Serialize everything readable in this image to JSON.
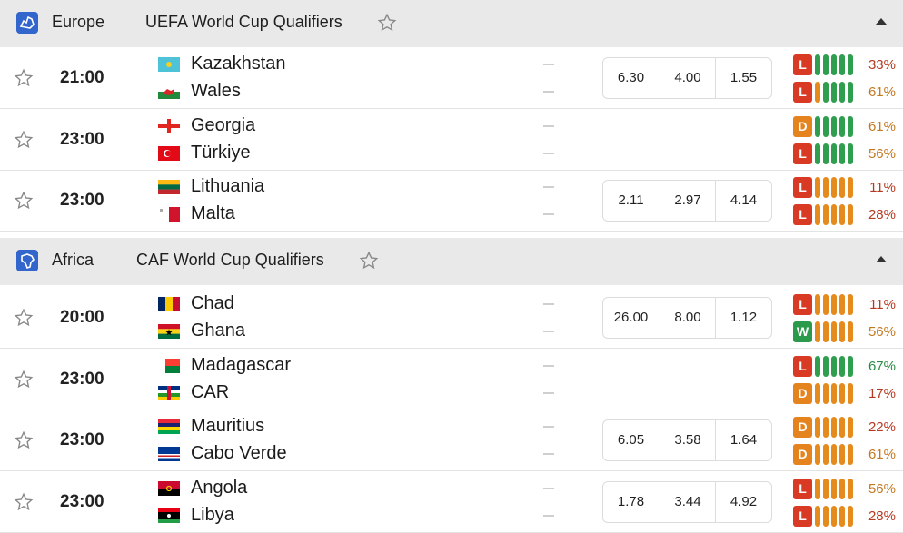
{
  "colors": {
    "L": "#d93a24",
    "D": "#e5831e",
    "W": "#2c9a4b",
    "pill_g": "#2f9e4f",
    "pill_o": "#e58a1d",
    "pct_red": "#b53a22",
    "pct_orange": "#c27820",
    "pct_green": "#2a8a45"
  },
  "icons": {
    "star": "star-outline-icon",
    "collapse": "chevron-up-icon",
    "europe": "europe-map-icon",
    "africa": "africa-map-icon"
  },
  "leagues": [
    {
      "region": "Europe",
      "name": "UEFA World Cup Qualifiers",
      "matches": [
        {
          "time": "21:00",
          "home": "Kazakhstan",
          "away": "Wales",
          "odds": [
            "6.30",
            "4.00",
            "1.55"
          ],
          "home_form": {
            "res": "L",
            "pills": "ggggg",
            "pct": "33%",
            "pc": "pct_red"
          },
          "away_form": {
            "res": "L",
            "pills": "ogggg",
            "pct": "61%",
            "pc": "pct_orange"
          }
        },
        {
          "time": "23:00",
          "home": "Georgia",
          "away": "Türkiye",
          "odds": [],
          "home_form": {
            "res": "D",
            "pills": "ggggg",
            "pct": "61%",
            "pc": "pct_orange"
          },
          "away_form": {
            "res": "L",
            "pills": "ggggg",
            "pct": "56%",
            "pc": "pct_orange"
          }
        },
        {
          "time": "23:00",
          "home": "Lithuania",
          "away": "Malta",
          "odds": [
            "2.11",
            "2.97",
            "4.14"
          ],
          "home_form": {
            "res": "L",
            "pills": "ooooo",
            "pct": "11%",
            "pc": "pct_red"
          },
          "away_form": {
            "res": "L",
            "pills": "ooooo",
            "pct": "28%",
            "pc": "pct_red"
          }
        }
      ]
    },
    {
      "region": "Africa",
      "name": "CAF World Cup Qualifiers",
      "matches": [
        {
          "time": "20:00",
          "home": "Chad",
          "away": "Ghana",
          "odds": [
            "26.00",
            "8.00",
            "1.12"
          ],
          "home_form": {
            "res": "L",
            "pills": "ooooo",
            "pct": "11%",
            "pc": "pct_red"
          },
          "away_form": {
            "res": "W",
            "pills": "ooooo",
            "pct": "56%",
            "pc": "pct_orange"
          }
        },
        {
          "time": "23:00",
          "home": "Madagascar",
          "away": "CAR",
          "odds": [],
          "home_form": {
            "res": "L",
            "pills": "ggggg",
            "pct": "67%",
            "pc": "pct_green"
          },
          "away_form": {
            "res": "D",
            "pills": "ooooo",
            "pct": "17%",
            "pc": "pct_red"
          }
        },
        {
          "time": "23:00",
          "home": "Mauritius",
          "away": "Cabo Verde",
          "odds": [
            "6.05",
            "3.58",
            "1.64"
          ],
          "home_form": {
            "res": "D",
            "pills": "ooooo",
            "pct": "22%",
            "pc": "pct_red"
          },
          "away_form": {
            "res": "D",
            "pills": "ooooo",
            "pct": "61%",
            "pc": "pct_orange"
          }
        },
        {
          "time": "23:00",
          "home": "Angola",
          "away": "Libya",
          "odds": [
            "1.78",
            "3.44",
            "4.92"
          ],
          "home_form": {
            "res": "L",
            "pills": "ooooo",
            "pct": "56%",
            "pc": "pct_orange"
          },
          "away_form": {
            "res": "L",
            "pills": "ooooo",
            "pct": "28%",
            "pc": "pct_red"
          }
        }
      ]
    }
  ]
}
